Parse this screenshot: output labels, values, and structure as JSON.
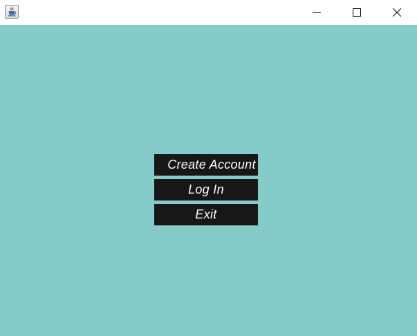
{
  "window": {
    "icon": "java-cup-icon",
    "controls": {
      "minimize_icon": "minimize-icon",
      "maximize_icon": "maximize-icon",
      "close_icon": "close-icon"
    }
  },
  "colors": {
    "background": "#85cbc9",
    "button_background": "#171717",
    "button_text": "#ffffff",
    "titlebar": "#ffffff"
  },
  "menu": {
    "create_account": "Create Account",
    "log_in": "Log In",
    "exit": "Exit"
  }
}
